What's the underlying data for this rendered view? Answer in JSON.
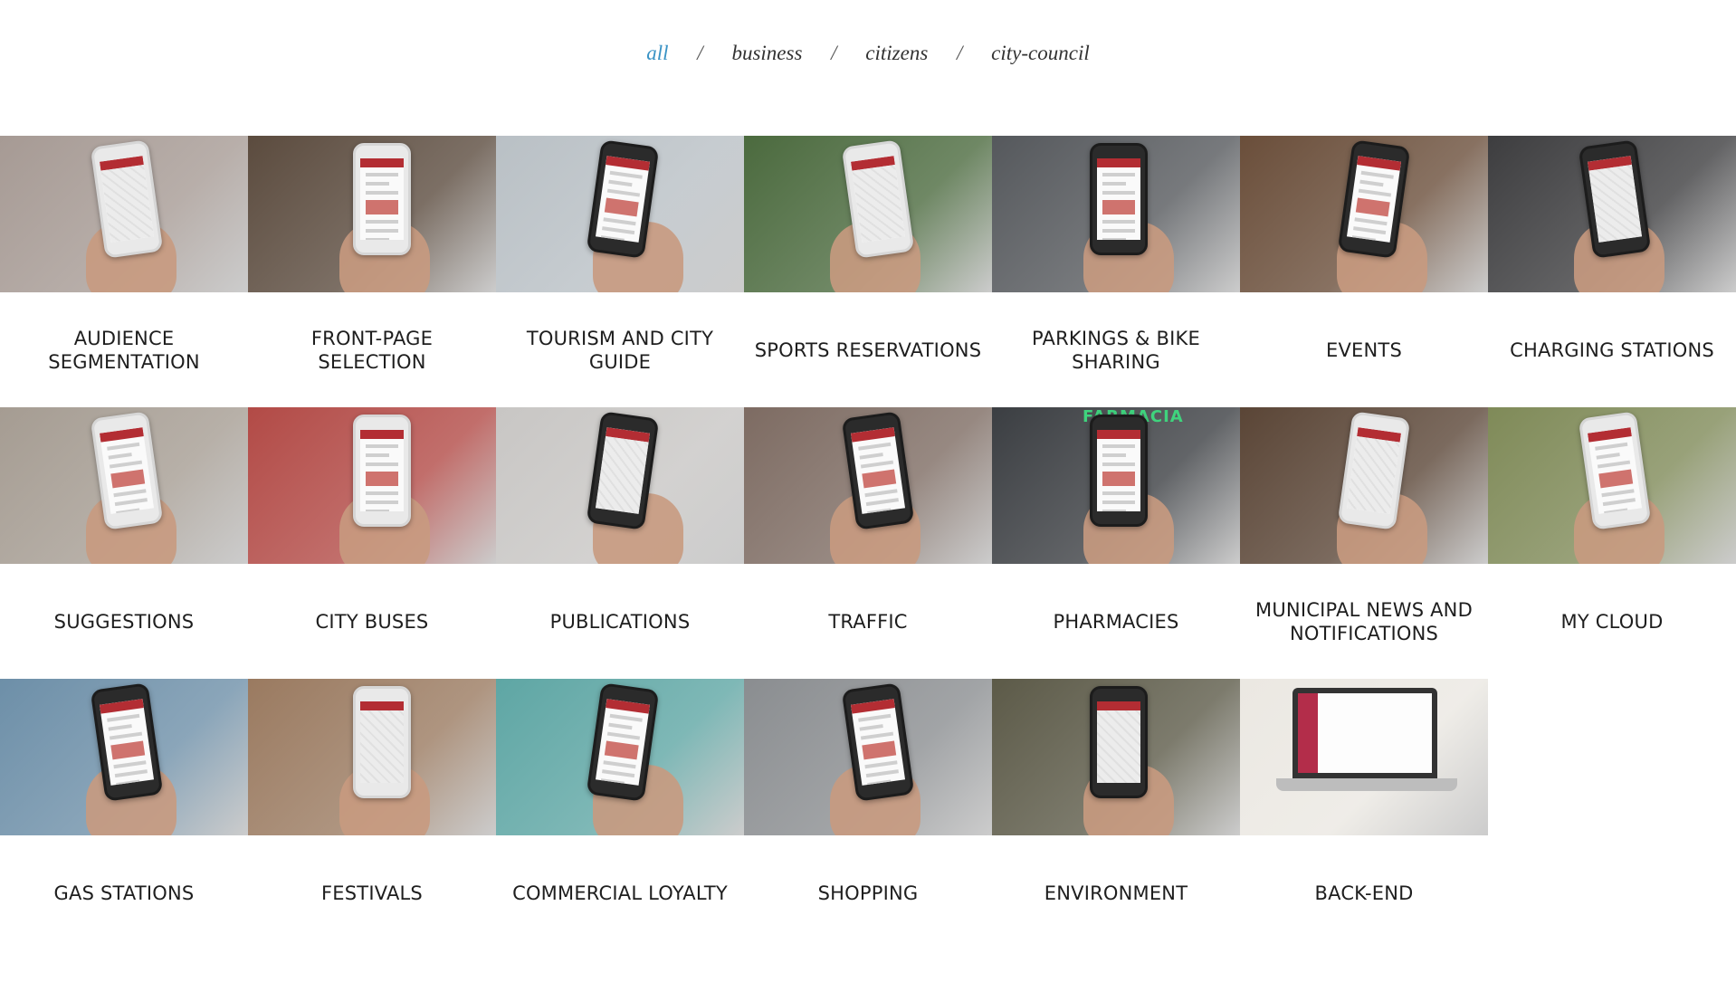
{
  "filters": {
    "all": "all",
    "business": "business",
    "citizens": "citizens",
    "city_council": "city-council",
    "separator": "/"
  },
  "colors": {
    "active_filter": "#3a93c5",
    "accent_red": "#b32d33"
  },
  "rows": [
    {
      "tiles": [
        {
          "label": "AUDIENCE SEGMENTATION",
          "bg": "#a69a94",
          "phone": "light"
        },
        {
          "label": "FRONT-PAGE SELECTION",
          "bg": "#5b4b3e",
          "phone": "light"
        },
        {
          "label": "TOURISM AND CITY GUIDE",
          "bg": "#b9c0c5",
          "phone": "dark"
        },
        {
          "label": "SPORTS RESERVATIONS",
          "bg": "#4b6a3e",
          "phone": "light"
        },
        {
          "label": "PARKINGS & BIKE SHARING",
          "bg": "#55585c",
          "phone": "dark"
        },
        {
          "label": "EVENTS",
          "bg": "#6a4e3a",
          "phone": "dark"
        },
        {
          "label": "CHARGING STATIONS",
          "bg": "#3d3d3f",
          "phone": "dark"
        }
      ]
    },
    {
      "tiles": [
        {
          "label": "SUGGESTIONS",
          "bg": "#a59c92",
          "phone": "light"
        },
        {
          "label": "CITY BUSES",
          "bg": "#b24a46",
          "phone": "light"
        },
        {
          "label": "PUBLICATIONS",
          "bg": "#c8c6c4",
          "phone": "dark"
        },
        {
          "label": "TRAFFIC",
          "bg": "#7d6b62",
          "phone": "dark"
        },
        {
          "label": "PHARMACIES",
          "bg": "#3b3e42",
          "phone": "dark",
          "sign": "FARMACIA"
        },
        {
          "label": "MUNICIPAL NEWS AND NOTIFICATIONS",
          "bg": "#5a4536",
          "phone": "light"
        },
        {
          "label": "MY CLOUD",
          "bg": "#7f8a58",
          "phone": "light"
        }
      ]
    },
    {
      "tiles": [
        {
          "label": "GAS STATIONS",
          "bg": "#6d8fa8",
          "phone": "dark"
        },
        {
          "label": "FESTIVALS",
          "bg": "#9a7a60",
          "phone": "light"
        },
        {
          "label": "COMMERCIAL LOYALTY",
          "bg": "#5ea6a4",
          "phone": "dark"
        },
        {
          "label": "SHOPPING",
          "bg": "#8a8d90",
          "phone": "dark"
        },
        {
          "label": "ENVIRONMENT",
          "bg": "#5c5a48",
          "phone": "dark"
        },
        {
          "label": "BACK-END",
          "bg": "#ebe8e2",
          "phone": "laptop"
        }
      ]
    }
  ]
}
